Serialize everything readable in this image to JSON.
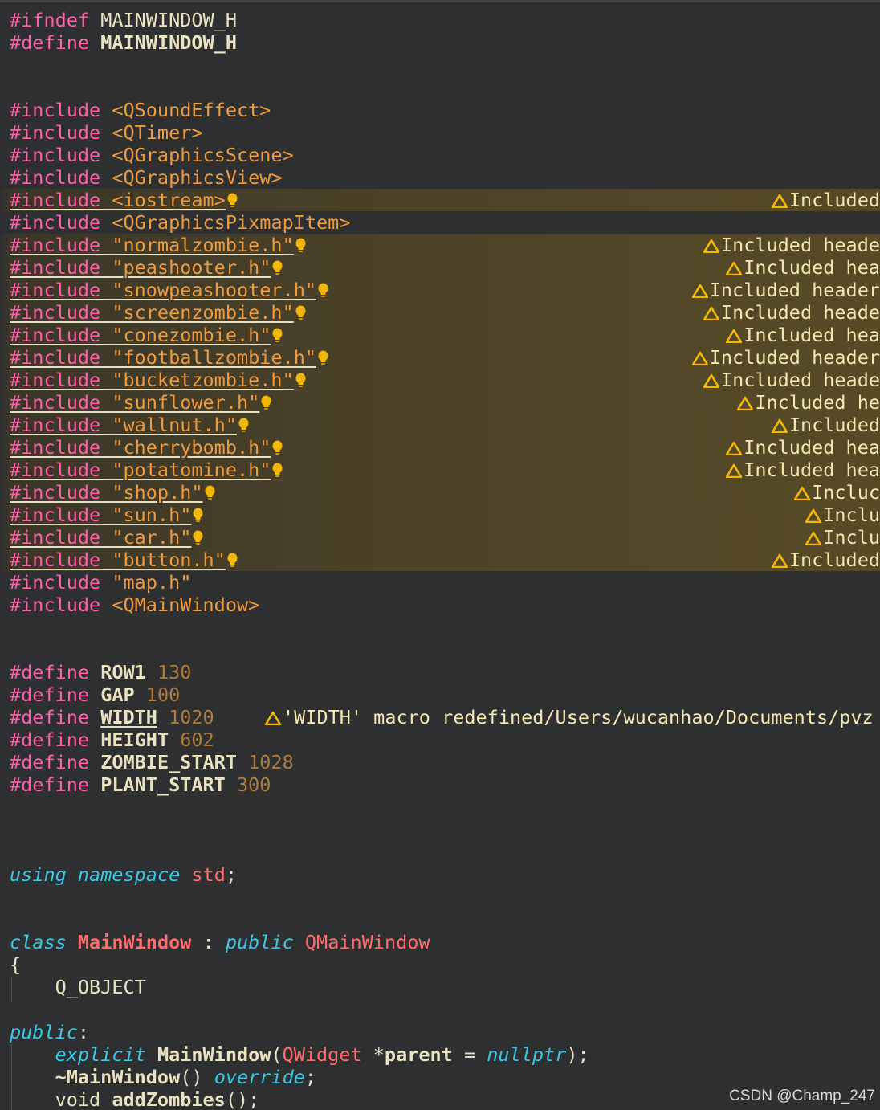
{
  "editor": {
    "lines": {
      "ifndef": {
        "directive": "#ifndef",
        "name": "MAINWINDOW_H"
      },
      "define_guard": {
        "directive": "#define",
        "name": "MAINWINDOW_H"
      },
      "inc_qsoundeffect": {
        "directive": "#include",
        "path": "<QSoundEffect>"
      },
      "inc_qtimer": {
        "directive": "#include",
        "path": "<QTimer>"
      },
      "inc_qgraphicsscene": {
        "directive": "#include",
        "path": "<QGraphicsScene>"
      },
      "inc_qgraphicsview": {
        "directive": "#include",
        "path": "<QGraphicsView>"
      },
      "inc_iostream": {
        "directive": "#include",
        "path": "<iostream>",
        "warning": "Included"
      },
      "inc_qgraphicspixmapitem": {
        "directive": "#include",
        "path": "<QGraphicsPixmapItem>"
      },
      "inc_normalzombie": {
        "directive": "#include",
        "path": "\"normalzombie.h\"",
        "warning": "Included heade"
      },
      "inc_peashooter": {
        "directive": "#include",
        "path": "\"peashooter.h\"",
        "warning": "Included hea"
      },
      "inc_snowpeashooter": {
        "directive": "#include",
        "path": "\"snowpeashooter.h\"",
        "warning": "Included header"
      },
      "inc_screenzombie": {
        "directive": "#include",
        "path": "\"screenzombie.h\"",
        "warning": "Included heade"
      },
      "inc_conezombie": {
        "directive": "#include",
        "path": "\"conezombie.h\"",
        "warning": "Included hea"
      },
      "inc_footballzombie": {
        "directive": "#include",
        "path": "\"footballzombie.h\"",
        "warning": "Included header"
      },
      "inc_bucketzombie": {
        "directive": "#include",
        "path": "\"bucketzombie.h\"",
        "warning": "Included heade"
      },
      "inc_sunflower": {
        "directive": "#include",
        "path": "\"sunflower.h\"",
        "warning": "Included he"
      },
      "inc_wallnut": {
        "directive": "#include",
        "path": "\"wallnut.h\"",
        "warning": "Included"
      },
      "inc_cherrybomb": {
        "directive": "#include",
        "path": "\"cherrybomb.h\"",
        "warning": "Included hea"
      },
      "inc_potatomine": {
        "directive": "#include",
        "path": "\"potatomine.h\"",
        "warning": "Included hea"
      },
      "inc_shop": {
        "directive": "#include",
        "path": "\"shop.h\"",
        "warning": "Incluc"
      },
      "inc_sun": {
        "directive": "#include",
        "path": "\"sun.h\"",
        "warning": "Inclu"
      },
      "inc_car": {
        "directive": "#include",
        "path": "\"car.h\"",
        "warning": "Inclu"
      },
      "inc_button": {
        "directive": "#include",
        "path": "\"button.h\"",
        "warning": "Included"
      },
      "inc_map": {
        "directive": "#include",
        "path": "\"map.h\""
      },
      "inc_qmainwindow": {
        "directive": "#include",
        "path": "<QMainWindow>"
      },
      "def_row1": {
        "directive": "#define",
        "name": "ROW1",
        "value": "130"
      },
      "def_gap": {
        "directive": "#define",
        "name": "GAP",
        "value": "100"
      },
      "def_width": {
        "directive": "#define",
        "name": "WIDTH",
        "value": "1020",
        "warning": "'WIDTH' macro redefined/Users/wucanhao/Documents/pvz"
      },
      "def_height": {
        "directive": "#define",
        "name": "HEIGHT",
        "value": "602"
      },
      "def_zombie_start": {
        "directive": "#define",
        "name": "ZOMBIE_START",
        "value": "1028"
      },
      "def_plant_start": {
        "directive": "#define",
        "name": "PLANT_START",
        "value": "300"
      },
      "using": {
        "kw1": "using",
        "kw2": "namespace",
        "ns": "std",
        "semi": ";"
      },
      "class_decl": {
        "kw": "class",
        "name": "MainWindow",
        "colon": ":",
        "access": "public",
        "base": "QMainWindow"
      },
      "brace_open": {
        "text": "{"
      },
      "q_object": {
        "text": "Q_OBJECT"
      },
      "public_label": {
        "kw": "public",
        "colon": ":"
      },
      "ctor": {
        "kw": "explicit",
        "name": "MainWindow",
        "open": "(",
        "ptype": "QWidget",
        "star": " *",
        "pname": "parent",
        "eq": " = ",
        "def": "nullptr",
        "close": ");"
      },
      "dtor": {
        "name": "~MainWindow",
        "parens": "()",
        "kw": "override",
        "semi": ";"
      },
      "add_zombies": {
        "type": "void",
        "name": "addZombies",
        "rest": "();"
      }
    }
  },
  "watermark": {
    "text": "CSDN @Champ_247"
  },
  "colors": {
    "background": "#2d2f31",
    "preprocessor": "#ff5fa8",
    "string": "#ef9a3c",
    "number": "#b07a3a",
    "keyword_italic": "#39c5e5",
    "class_name": "#ff6b6b",
    "warning_icon": "#f2b705"
  },
  "icons": {
    "warning": "warning-triangle-icon",
    "quickfix": "lightbulb-icon"
  }
}
